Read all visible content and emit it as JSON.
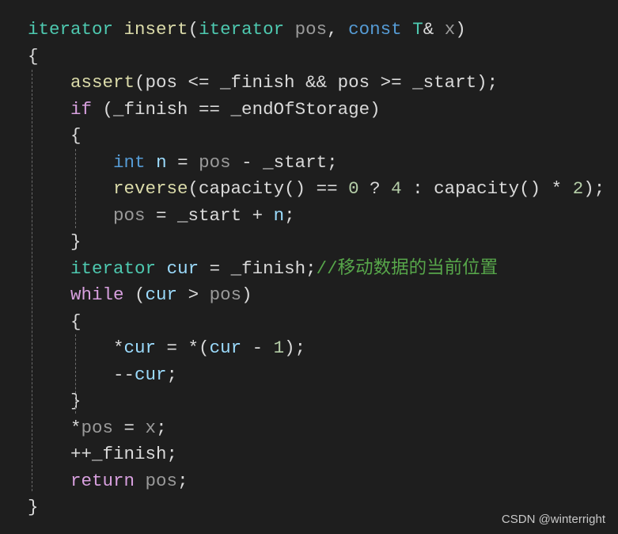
{
  "colors": {
    "background": "#1e1e1e",
    "type": "#4ec9b0",
    "function": "#dcdcaa",
    "keyword": "#569cd6",
    "control": "#d8a0df",
    "param": "#9a9a9a",
    "local": "#9cdcfe",
    "plain": "#dadada",
    "number": "#b5cea8",
    "comment": "#57a64a"
  },
  "code_lines": [
    [
      [
        "type",
        "iterator"
      ],
      [
        "plain",
        " "
      ],
      [
        "function",
        "insert"
      ],
      [
        "plain",
        "("
      ],
      [
        "type",
        "iterator"
      ],
      [
        "plain",
        " "
      ],
      [
        "param",
        "pos"
      ],
      [
        "plain",
        ", "
      ],
      [
        "keyword",
        "const"
      ],
      [
        "plain",
        " "
      ],
      [
        "type",
        "T"
      ],
      [
        "plain",
        "& "
      ],
      [
        "param",
        "x"
      ],
      [
        "plain",
        ")"
      ]
    ],
    [
      [
        "plain",
        "{"
      ]
    ],
    [
      [
        "plain",
        "    "
      ],
      [
        "function",
        "assert"
      ],
      [
        "plain",
        "(pos <= _finish && pos >= _start);"
      ]
    ],
    [
      [
        "plain",
        "    "
      ],
      [
        "control",
        "if"
      ],
      [
        "plain",
        " (_finish == _endOfStorage)"
      ]
    ],
    [
      [
        "plain",
        "    {"
      ]
    ],
    [
      [
        "plain",
        "        "
      ],
      [
        "keyword",
        "int"
      ],
      [
        "plain",
        " "
      ],
      [
        "local",
        "n"
      ],
      [
        "plain",
        " = "
      ],
      [
        "param",
        "pos"
      ],
      [
        "plain",
        " - _start;"
      ]
    ],
    [
      [
        "plain",
        "        "
      ],
      [
        "function",
        "reverse"
      ],
      [
        "plain",
        "(capacity() == "
      ],
      [
        "number",
        "0"
      ],
      [
        "plain",
        " ? "
      ],
      [
        "number",
        "4"
      ],
      [
        "plain",
        " : capacity() * "
      ],
      [
        "number",
        "2"
      ],
      [
        "plain",
        ");"
      ]
    ],
    [
      [
        "plain",
        "        "
      ],
      [
        "param",
        "pos"
      ],
      [
        "plain",
        " = _start + "
      ],
      [
        "local",
        "n"
      ],
      [
        "plain",
        ";"
      ]
    ],
    [
      [
        "plain",
        "    }"
      ]
    ],
    [
      [
        "plain",
        "    "
      ],
      [
        "type",
        "iterator"
      ],
      [
        "plain",
        " "
      ],
      [
        "local",
        "cur"
      ],
      [
        "plain",
        " = _finish;"
      ],
      [
        "comment",
        "//移动数据的当前位置"
      ]
    ],
    [
      [
        "plain",
        "    "
      ],
      [
        "control",
        "while"
      ],
      [
        "plain",
        " ("
      ],
      [
        "local",
        "cur"
      ],
      [
        "plain",
        " > "
      ],
      [
        "param",
        "pos"
      ],
      [
        "plain",
        ")"
      ]
    ],
    [
      [
        "plain",
        "    {"
      ]
    ],
    [
      [
        "plain",
        "        *"
      ],
      [
        "local",
        "cur"
      ],
      [
        "plain",
        " = *("
      ],
      [
        "local",
        "cur"
      ],
      [
        "plain",
        " - "
      ],
      [
        "number",
        "1"
      ],
      [
        "plain",
        ");"
      ]
    ],
    [
      [
        "plain",
        "        --"
      ],
      [
        "local",
        "cur"
      ],
      [
        "plain",
        ";"
      ]
    ],
    [
      [
        "plain",
        "    }"
      ]
    ],
    [
      [
        "plain",
        "    *"
      ],
      [
        "param",
        "pos"
      ],
      [
        "plain",
        " = "
      ],
      [
        "param",
        "x"
      ],
      [
        "plain",
        ";"
      ]
    ],
    [
      [
        "plain",
        "    ++_finish;"
      ]
    ],
    [
      [
        "plain",
        "    "
      ],
      [
        "control",
        "return"
      ],
      [
        "plain",
        " "
      ],
      [
        "param",
        "pos"
      ],
      [
        "plain",
        ";"
      ]
    ],
    [
      [
        "plain",
        "}"
      ]
    ]
  ],
  "watermark": "CSDN @winterright"
}
